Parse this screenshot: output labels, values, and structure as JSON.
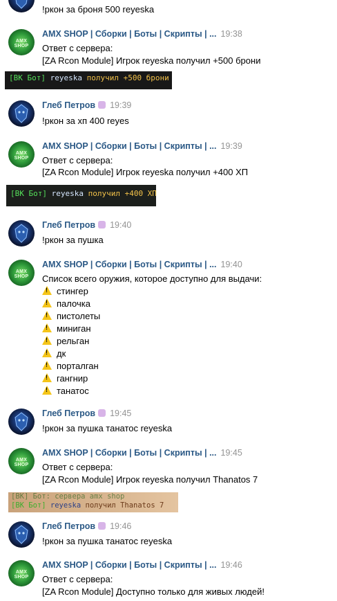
{
  "colors": {
    "author": "#2a5885",
    "time": "#939393",
    "warn": "#f5c518"
  },
  "icons": {
    "warning": "warning-icon",
    "emoji": "emoji-icon"
  },
  "top_text": "!ркон за броня 500 reyeska",
  "messages": [
    {
      "author": "AMX SHOP | Сборки | Боты | Скрипты | ...",
      "time": "19:38",
      "lines": [
        "Ответ с сервера:",
        "[ZA Rcon Module] Игрок reyeska получил +500 брони"
      ]
    },
    {
      "author": "Глеб Петров",
      "time": "19:39",
      "lines": [
        "!ркон за хп 400 reyes"
      ]
    },
    {
      "author": "AMX SHOP | Сборки | Боты | Скрипты | ...",
      "time": "19:39",
      "lines": [
        "Ответ с сервера:",
        "[ZA Rcon Module] Игрок reyeska получил +400 ХП"
      ]
    },
    {
      "author": "Глеб Петров",
      "time": "19:40",
      "lines": [
        "!ркон за пушка"
      ]
    },
    {
      "author": "AMX SHOP | Сборки | Боты | Скрипты | ...",
      "time": "19:40",
      "lines": [
        "Список всего оружия, которое доступно для выдачи:"
      ],
      "list": [
        "стингер",
        "палочка",
        "пистолеты",
        "миниган",
        "рельган",
        "дк",
        "порталган",
        "гангнир",
        "танатос"
      ]
    },
    {
      "author": "Глеб Петров",
      "time": "19:45",
      "lines": [
        "!ркон за пушка танатос reyeska"
      ]
    },
    {
      "author": "AMX SHOP | Сборки | Боты | Скрипты | ...",
      "time": "19:45",
      "lines": [
        "Ответ с сервера:",
        "[ZA Rcon Module] Игрок reyeska получил Thanatos 7"
      ]
    },
    {
      "author": "Глеб Петров",
      "time": "19:46",
      "lines": [
        "!ркон за пушка танатос reyeska"
      ]
    },
    {
      "author": "AMX SHOP | Сборки | Боты | Скрипты | ...",
      "time": "19:46",
      "lines": [
        "Ответ с сервера:",
        "[ZA Rcon Module] Доступно только для живых людей!"
      ]
    }
  ],
  "game_shots": [
    {
      "bot": "[ВК Бот]",
      "nick": "reyeska",
      "text": "получил +500 брони"
    },
    {
      "bot": "[ВК Бот]",
      "nick": "reyeska",
      "text": "получил +400 ХП"
    },
    {
      "top": "[ВК] Бот: сервера amx shop",
      "bot": "[ВК Бот]",
      "nick": "reyeska",
      "text": "получил Thanatos 7"
    }
  ],
  "amx_avatar_text": "AMX SHOP"
}
